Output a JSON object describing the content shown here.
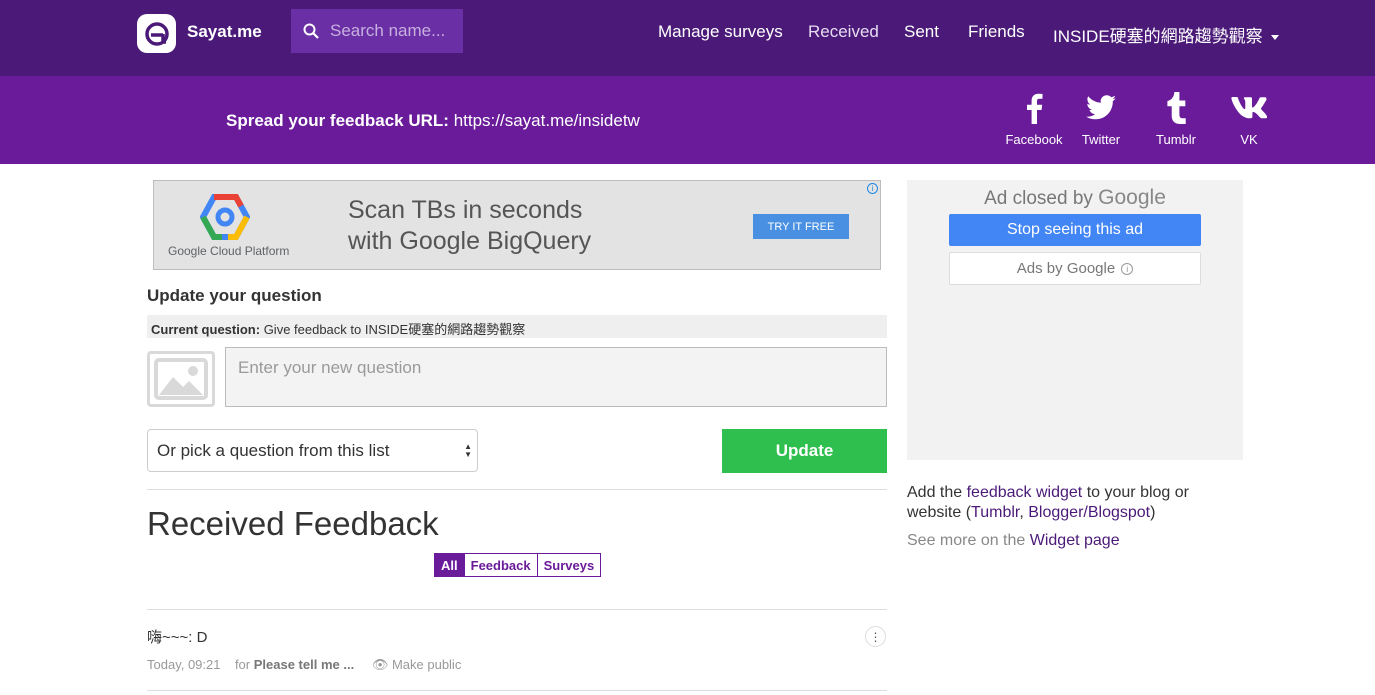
{
  "header": {
    "brand": "Sayat.me",
    "search_placeholder": "Search name...",
    "nav": {
      "manage_surveys": "Manage surveys",
      "received": "Received",
      "sent": "Sent",
      "friends": "Friends",
      "account": "INSIDE硬塞的網路趨勢觀察"
    }
  },
  "spread": {
    "label": "Spread your feedback URL:",
    "url": "https://sayat.me/insidetw",
    "social": {
      "facebook": "Facebook",
      "twitter": "Twitter",
      "tumblr": "Tumblr",
      "vk": "VK"
    }
  },
  "ad_banner": {
    "brand": "Google Cloud Platform",
    "headline_line1": "Scan TBs in seconds",
    "headline_line2": "with Google BigQuery",
    "cta": "TRY IT FREE"
  },
  "update_question": {
    "title": "Update your question",
    "current_label": "Current question:",
    "current_value": "Give feedback to INSIDE硬塞的網路趨勢觀察",
    "input_placeholder": "Enter your new question",
    "pick_label": "Or pick a question from this list",
    "update_button": "Update"
  },
  "received": {
    "title": "Received Feedback",
    "filters": {
      "all": "All",
      "feedback": "Feedback",
      "surveys": "Surveys"
    },
    "items": [
      {
        "text": "嗨~~~: D",
        "time": "Today, 09:21",
        "for_label": "for",
        "for_value": "Please tell me ...",
        "make_public": "Make public"
      }
    ]
  },
  "sidebar": {
    "ad_closed_prefix": "Ad closed by",
    "ad_closed_brand": "Google",
    "stop_seeing": "Stop seeing this ad",
    "ads_by": "Ads by Google",
    "widget_prefix": "Add the",
    "widget_link": "feedback widget",
    "widget_mid": "to your blog or website (",
    "tumblr_link": "Tumblr",
    "sep": ",",
    "blogger_link": "Blogger/Blogspot",
    "widget_suffix": ")",
    "more_prefix": "See more on the",
    "more_link": "Widget page"
  },
  "colors": {
    "nav_bg": "#4b1a78",
    "spread_bg": "#6a1b9a",
    "search_bg": "#6a2fa4",
    "update_green": "#2fbf4f",
    "ad_cta_blue": "#4a90e2",
    "stop_blue": "#4285f4"
  }
}
